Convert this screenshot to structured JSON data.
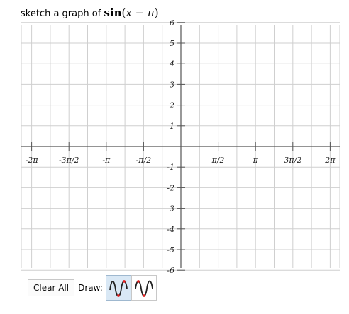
{
  "prompt": {
    "text": "sketch a graph of",
    "math_fn": "sin",
    "math_open": "(",
    "math_var": "x",
    "math_op": " − ",
    "math_const": "π",
    "math_close": ")"
  },
  "graph": {
    "x_range": [
      -6.2832,
      6.2832
    ],
    "y_range": [
      -6,
      6
    ],
    "x_ticks": [
      {
        "value": -6.2832,
        "label": "-2π"
      },
      {
        "value": -4.7124,
        "label": "-3π/2"
      },
      {
        "value": -3.1416,
        "label": "-π"
      },
      {
        "value": -1.5708,
        "label": "-π/2"
      },
      {
        "value": 1.5708,
        "label": "π/2"
      },
      {
        "value": 3.1416,
        "label": "π"
      },
      {
        "value": 4.7124,
        "label": "3π/2"
      },
      {
        "value": 6.2832,
        "label": "2π"
      }
    ],
    "y_ticks": [
      {
        "value": 6,
        "label": "6"
      },
      {
        "value": 5,
        "label": "5"
      },
      {
        "value": 4,
        "label": "4"
      },
      {
        "value": 3,
        "label": "3"
      },
      {
        "value": 2,
        "label": "2"
      },
      {
        "value": 1,
        "label": "1"
      },
      {
        "value": -1,
        "label": "-1"
      },
      {
        "value": -2,
        "label": "-2"
      },
      {
        "value": -3,
        "label": "-3"
      },
      {
        "value": -4,
        "label": "-4"
      },
      {
        "value": -5,
        "label": "-5"
      },
      {
        "value": -6,
        "label": "-6"
      }
    ],
    "grid_divisions_per_tick": 2,
    "colors": {
      "grid": "#cfcfcf",
      "axis": "#555555",
      "tick_label": "#222222"
    }
  },
  "controls": {
    "clear_label": "Clear All",
    "draw_label": "Draw:",
    "modes": [
      {
        "name": "sine-curve-mode",
        "icon": "sine-wave-icon",
        "active": true
      },
      {
        "name": "sine-curve-alt-mode",
        "icon": "sine-wave-icon",
        "active": false
      }
    ],
    "icon_colors": {
      "curve": "#222222",
      "point": "#e02020"
    }
  }
}
